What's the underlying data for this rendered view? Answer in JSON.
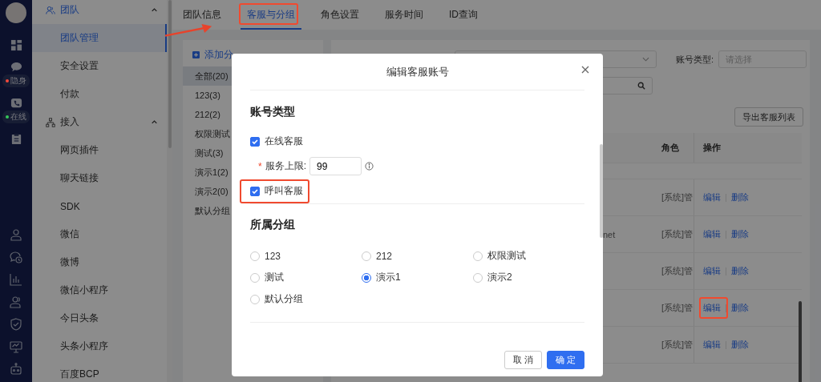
{
  "rail": {
    "badges": [
      {
        "label": "隐身",
        "color": "#f5483b"
      },
      {
        "label": "在线",
        "color": "#34c759"
      }
    ]
  },
  "sidebar": {
    "sections": [
      {
        "label": "团队",
        "expanded": true,
        "children": [
          {
            "label": "团队管理",
            "selected": true
          },
          {
            "label": "安全设置",
            "selected": false
          },
          {
            "label": "付款",
            "selected": false
          }
        ]
      },
      {
        "label": "接入",
        "expanded": true,
        "children": [
          {
            "label": "网页插件",
            "selected": false
          },
          {
            "label": "聊天链接",
            "selected": false
          },
          {
            "label": "SDK",
            "selected": false
          },
          {
            "label": "微信",
            "selected": false
          },
          {
            "label": "微博",
            "selected": false
          },
          {
            "label": "微信小程序",
            "selected": false
          },
          {
            "label": "今日头条",
            "selected": false
          },
          {
            "label": "头条小程序",
            "selected": false
          },
          {
            "label": "百度BCP",
            "selected": false
          }
        ]
      }
    ]
  },
  "tabs": [
    {
      "label": "团队信息",
      "selected": false,
      "highlighted": false
    },
    {
      "label": "客服与分组",
      "selected": true,
      "highlighted": true
    },
    {
      "label": "角色设置",
      "selected": false,
      "highlighted": false
    },
    {
      "label": "服务时间",
      "selected": false,
      "highlighted": false
    },
    {
      "label": "ID查询",
      "selected": false,
      "highlighted": false
    }
  ],
  "groups": {
    "add_label": "添加分",
    "items": [
      {
        "label": "全部(20)",
        "selected": true
      },
      {
        "label": "123(3)",
        "selected": false
      },
      {
        "label": "212(2)",
        "selected": false
      },
      {
        "label": "权限测试",
        "selected": false
      },
      {
        "label": "测试(3)",
        "selected": false
      },
      {
        "label": "演示1(2)",
        "selected": false
      },
      {
        "label": "演示2(0)",
        "selected": false
      },
      {
        "label": "默认分组",
        "selected": false
      }
    ]
  },
  "filters": {
    "account_type_label": "账号类型:",
    "account_type_placeholder": "请选择"
  },
  "export_button": "导出客服列表",
  "table": {
    "columns": [
      "角色",
      "操作"
    ],
    "rows": [
      {
        "column_1": "",
        "role": "[系统]管",
        "edit": "编辑",
        "delete": "删除",
        "highlighted": false
      },
      {
        "column_1": "net",
        "role": "[系统]管",
        "edit": "编辑",
        "delete": "删除",
        "highlighted": false
      },
      {
        "column_1": "",
        "role": "[系统]管",
        "edit": "编辑",
        "delete": "删除",
        "highlighted": false
      },
      {
        "column_1": "",
        "role": "[系统]管",
        "edit": "编辑",
        "delete": "删除",
        "highlighted": true
      },
      {
        "column_1": "",
        "role": "[系统]管",
        "edit": "编辑",
        "delete": "删除",
        "highlighted": false
      }
    ]
  },
  "modal": {
    "title": "编辑客服账号",
    "account_type": {
      "heading": "账号类型",
      "fields": [
        {
          "kind": "checkbox",
          "label": "在线客服",
          "checked": true,
          "highlighted": false
        },
        {
          "kind": "number",
          "required_mark": "*",
          "label": "服务上限:",
          "value": "99"
        },
        {
          "kind": "checkbox",
          "label": "呼叫客服",
          "checked": true,
          "highlighted": true
        }
      ]
    },
    "group": {
      "heading": "所属分组",
      "options": [
        {
          "label": "123",
          "selected": false
        },
        {
          "label": "212",
          "selected": false
        },
        {
          "label": "权限测试",
          "selected": false
        },
        {
          "label": "测试",
          "selected": false
        },
        {
          "label": "演示1",
          "selected": true
        },
        {
          "label": "演示2",
          "selected": false
        },
        {
          "label": "默认分组",
          "selected": false
        }
      ]
    },
    "buttons": [
      {
        "label": "取 消",
        "kind": "default"
      },
      {
        "label": "确 定",
        "kind": "primary"
      }
    ]
  }
}
